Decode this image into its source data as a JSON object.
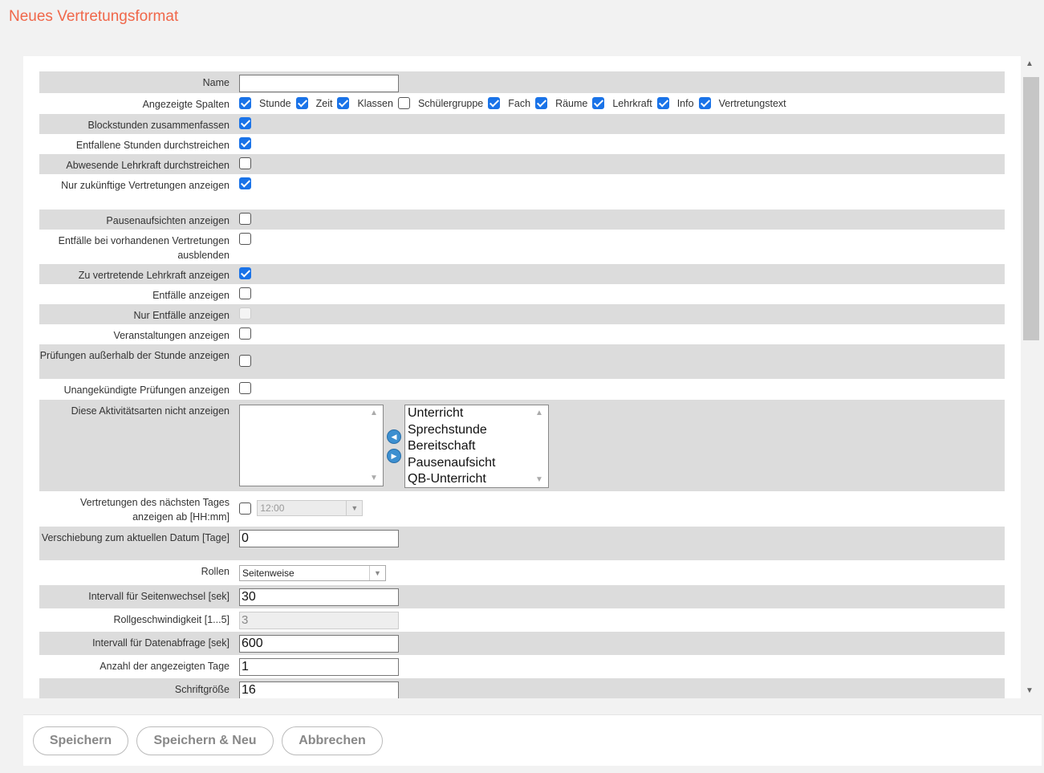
{
  "page_title": "Neues Vertretungsformat",
  "form": {
    "name": {
      "label": "Name",
      "value": ""
    },
    "columns": {
      "label": "Angezeigte Spalten",
      "items": [
        {
          "label": "Stunde",
          "checked": true
        },
        {
          "label": "Zeit",
          "checked": true
        },
        {
          "label": "Klassen",
          "checked": true
        },
        {
          "label": "Schülergruppe",
          "checked": false
        },
        {
          "label": "Fach",
          "checked": true
        },
        {
          "label": "Räume",
          "checked": true
        },
        {
          "label": "Lehrkraft",
          "checked": true
        },
        {
          "label": "Info",
          "checked": true
        },
        {
          "label": "Vertretungstext",
          "checked": true
        }
      ]
    },
    "rows": [
      {
        "label": "Blockstunden zusammenfassen",
        "checked": true
      },
      {
        "label": "Entfallene Stunden durchstreichen",
        "checked": true
      },
      {
        "label": "Abwesende Lehrkraft durchstreichen",
        "checked": false
      },
      {
        "label": "Nur zukünftige Vertretungen anzeigen",
        "checked": true
      },
      {
        "label": "Pausenaufsichten anzeigen",
        "checked": false
      },
      {
        "label": "Entfälle bei vorhandenen Vertretungen ausblenden",
        "checked": false
      },
      {
        "label": "Zu vertretende Lehrkraft anzeigen",
        "checked": true
      },
      {
        "label": "Entfälle anzeigen",
        "checked": false
      },
      {
        "label": "Nur Entfälle anzeigen",
        "checked": false,
        "disabled": true
      },
      {
        "label": "Veranstaltungen anzeigen",
        "checked": false
      },
      {
        "label": "Prüfungen außerhalb der Stunde anzeigen",
        "checked": false
      },
      {
        "label": "Unangekündigte Prüfungen anzeigen",
        "checked": false
      }
    ],
    "activity_types": {
      "label": "Diese Aktivitätsarten nicht anzeigen",
      "selected": [],
      "available": [
        "Unterricht",
        "Sprechstunde",
        "Bereitschaft",
        "Pausenaufsicht",
        "QB-Unterricht"
      ]
    },
    "next_day": {
      "label": "Vertretungen des nächsten Tages anzeigen ab [HH:mm]",
      "checked": false,
      "time": "12:00"
    },
    "shift": {
      "label": "Verschiebung zum aktuellen Datum [Tage]",
      "value": "0"
    },
    "scroll": {
      "label": "Rollen",
      "value": "Seitenweise"
    },
    "page_interval": {
      "label": "Intervall für Seitenwechsel [sek]",
      "value": "30"
    },
    "scroll_speed": {
      "label": "Rollgeschwindigkeit [1...5]",
      "value": "3"
    },
    "fetch_interval": {
      "label": "Intervall für Datenabfrage [sek]",
      "value": "600"
    },
    "days_count": {
      "label": "Anzahl der angezeigten Tage",
      "value": "1"
    },
    "font_size": {
      "label": "Schriftgröße",
      "value": "16"
    }
  },
  "buttons": {
    "save": "Speichern",
    "save_new": "Speichern & Neu",
    "cancel": "Abbrechen"
  },
  "colors": {
    "title": "#f0674a",
    "row_alt": "#dcdcdc",
    "check": "#1a73e8"
  }
}
